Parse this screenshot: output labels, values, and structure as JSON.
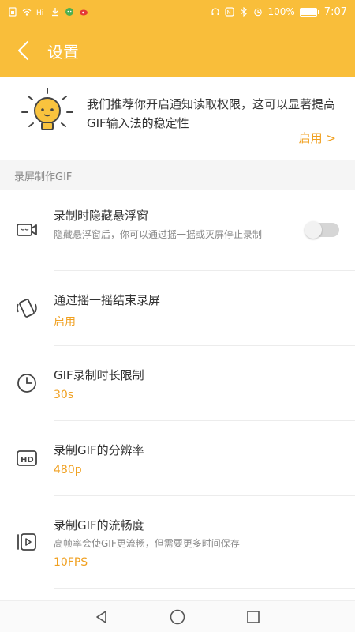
{
  "status_bar": {
    "battery": "100%",
    "battery_level": 1.0,
    "time": "7:07",
    "left_icons": [
      "sim-icon",
      "wifi-icon",
      "hd-icon",
      "download-icon",
      "wechat-icon",
      "weibo-icon"
    ],
    "right_icons": [
      "headset-icon",
      "nfc-icon",
      "bluetooth-icon",
      "alarm-icon",
      "battery-icon"
    ]
  },
  "header": {
    "title": "设置",
    "back_icon": "chevron-left-icon"
  },
  "banner": {
    "icon": "lightbulb-icon",
    "text": "我们推荐你开启通知读取权限，这可以显著提高GIF输入法的稳定性",
    "enable_label": "启用 >"
  },
  "section": {
    "title": "录屏制作GIF"
  },
  "rows": [
    {
      "icon": "video-camera-icon",
      "title": "录制时隐藏悬浮窗",
      "description": "隐藏悬浮窗后，你可以通过摇一摇或灭屏停止录制",
      "toggle_on": false
    },
    {
      "icon": "shake-phone-icon",
      "title": "通过摇一摇结束录屏",
      "value": "启用"
    },
    {
      "icon": "clock-icon",
      "title": "GIF录制时长限制",
      "value": "30s"
    },
    {
      "icon": "hd-badge-icon",
      "title": "录制GIF的分辨率",
      "value": "480p"
    },
    {
      "icon": "play-frames-icon",
      "title": "录制GIF的流畅度",
      "description": "高帧率会使GIF更流畅，但需要更多时间保存",
      "value": "10FPS"
    }
  ],
  "nav_bar": {
    "buttons": [
      "back-triangle-icon",
      "home-circle-icon",
      "recents-square-icon"
    ]
  },
  "colors": {
    "accent": "#f9be3a",
    "value_text": "#f0a020",
    "title_text": "#333333",
    "secondary_text": "#888888"
  }
}
